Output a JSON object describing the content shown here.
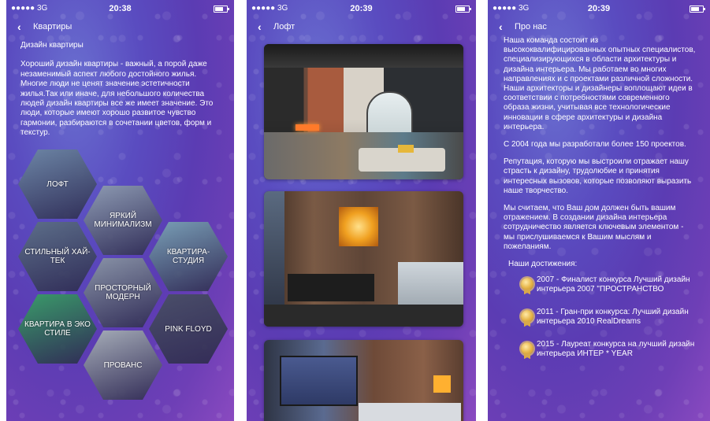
{
  "status": {
    "carrier": "●●●●● 3G"
  },
  "screens": [
    {
      "time": "20:38",
      "nav_title": "Квартиры",
      "heading": "Дизайн квартиры",
      "body": "Хороший дизайн квартиры - важный, а порой даже незаменимый аспект любого достойного жилья. Многие люди не ценят значение эстетичности жилья.Так или иначе, для небольшого количества людей дизайн квартиры все же имеет значение. Это люди, которые имеют хорошо развитое чувство гармонии, разбираются в сочетании цветов, форм и текстур.",
      "categories": [
        {
          "label": "ЛОФТ",
          "color": "#6d86a6"
        },
        {
          "label": "ЯРКИЙ МИНИМАЛИЗМ",
          "color": "#8e9bb3"
        },
        {
          "label": "СТИЛЬНЫЙ ХАЙ-ТЕК",
          "color": "#5d6f8a"
        },
        {
          "label": "КВАРТИРА-СТУДИЯ",
          "color": "#7aa0b7"
        },
        {
          "label": "ПРОСТОРНЫЙ МОДЕРН",
          "color": "#8a94a8"
        },
        {
          "label": "КВАРТИРА В ЭКО СТИЛЕ",
          "color": "#3a9c6a"
        },
        {
          "label": "PINK FLOYD",
          "color": "#4b4f6a"
        },
        {
          "label": "ПРОВАНС",
          "color": "#a7aeb9"
        }
      ]
    },
    {
      "time": "20:39",
      "nav_title": "Лофт",
      "photos": [
        "loft-interior-1",
        "loft-interior-2",
        "loft-interior-3"
      ]
    },
    {
      "time": "20:39",
      "nav_title": "Про нас",
      "paragraphs": [
        "Наша команда состоит из высококвалифицированных опытных специалистов, специализирующихся в области архитектуры и дизайна интерьера. Мы работаем во многих направлениях и с проектами различной сложности. Наши архитекторы и дизайнеры воплощают идеи в соответствии с потребностями современного образа жизни, учитывая все технологические инновации в сфере архитектуры и дизайна интерьера.",
        "С 2004 года мы разработали более 150 проектов.",
        "Репутация, которую мы выстроили отражает нашу страсть к дизайну, трудолюбие и принятия интересных вызовов, которые позволяют выразить наше творчество.",
        "Мы считаем, что Ваш дом должен быть вашим отражением. В создании дизайна интерьера сотрудничество является ключевым элементом - мы прислушиваемся к Вашим мыслям и пожеланиям."
      ],
      "achievements_title": "Наши достижения:",
      "achievements": [
        "2007 - Финалист конкурса Лучший дизайн интерьера 2007 \"ПРОСТРАНСТВО",
        "2011 - Гран-при конкурса: Лучший дизайн интерьера 2010 RealDreams",
        "2015 - Лауреат конкурса на лучший дизайн интерьера  ИНТЕР * YEAR"
      ]
    }
  ]
}
